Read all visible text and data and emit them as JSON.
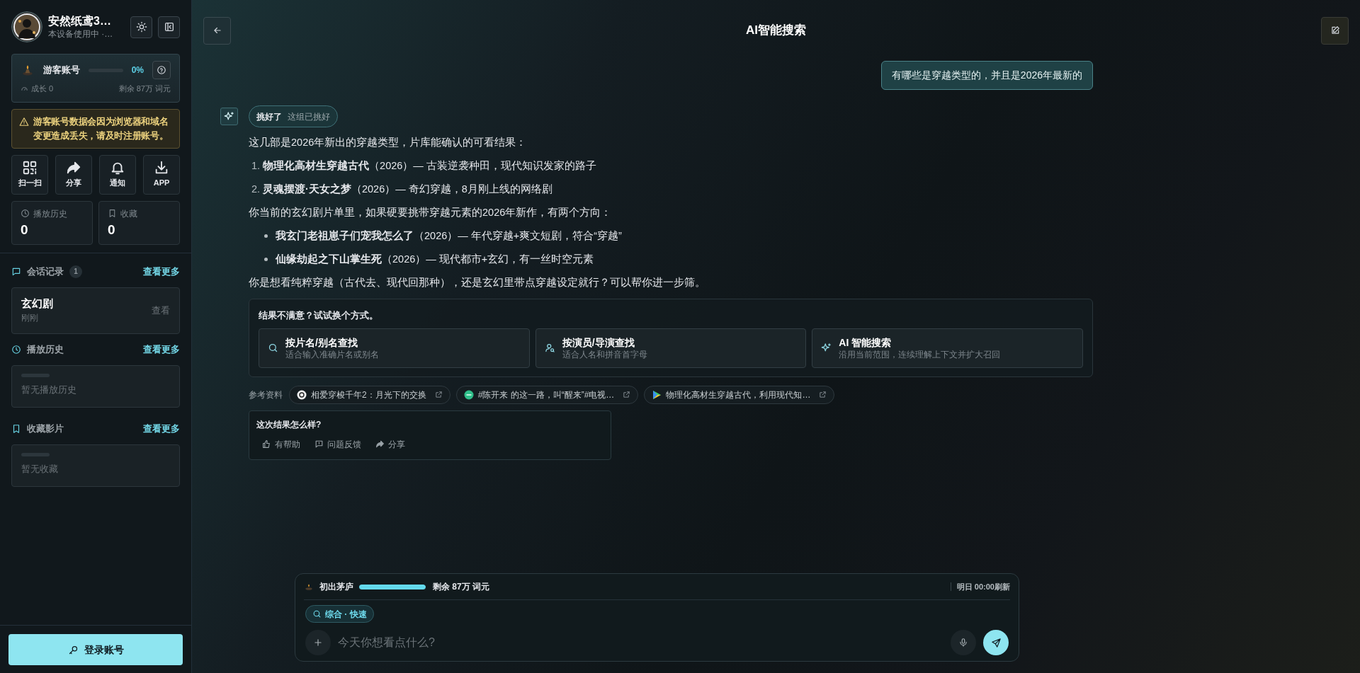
{
  "sidebar": {
    "profile": {
      "name": "安然纸鸢3…",
      "subtitle": "本设备使用中 ·…"
    },
    "account": {
      "label": "游客账号",
      "level": 0,
      "percent": "0%",
      "growth": "成长 0",
      "remaining": "剩余 87万 词元"
    },
    "warning": "游客账号数据会因为浏览器和域名变更造成丢失，请及时注册账号。",
    "quick_actions": [
      {
        "label": "扫一扫",
        "kind": "qr"
      },
      {
        "label": "分享",
        "kind": "share"
      },
      {
        "label": "通知",
        "kind": "bell"
      },
      {
        "label": "APP",
        "kind": "download"
      }
    ],
    "stats": [
      {
        "label": "播放历史",
        "value": "0",
        "kind": "clock"
      },
      {
        "label": "收藏",
        "value": "0",
        "kind": "bookmark"
      }
    ],
    "sections": [
      {
        "title": "会话记录",
        "count": "1",
        "more": "查看更多",
        "kind": "chat",
        "items": [
          {
            "title": "玄幻剧",
            "time": "刚刚",
            "action": "查看"
          }
        ]
      },
      {
        "title": "播放历史",
        "more": "查看更多",
        "kind": "clock",
        "empty": "暂无播放历史"
      },
      {
        "title": "收藏影片",
        "more": "查看更多",
        "kind": "bookmark",
        "empty": "暂无收藏"
      }
    ],
    "login_button": "登录账号"
  },
  "header": {
    "title": "AI智能搜索"
  },
  "user_message": "有哪些是穿越类型的，并且是2026年最新的",
  "assistant": {
    "badge": "挑好了",
    "badge_note": "这组已挑好",
    "blocks": [
      {
        "kind": "paragraph",
        "text": "这几部是2026年新出的穿越类型，片库能确认的可看结果："
      },
      {
        "kind": "ordered",
        "items": [
          {
            "number": "1.",
            "text": "**物理化高材生穿越古代**（2026）— 古装逆袭种田，现代知识发家的路子"
          },
          {
            "number": "2.",
            "text": "**灵魂摆渡·天女之梦**（2026）— 奇幻穿越，8月刚上线的网络剧"
          }
        ]
      },
      {
        "kind": "paragraph",
        "text": "你当前的玄幻剧片单里，如果硬要挑带穿越元素的2026年新作，有两个方向："
      },
      {
        "kind": "bullets",
        "items": [
          {
            "text": "**我玄门老祖崽子们宠我怎么了**（2026）— 年代穿越+爽文短剧，符合“穿越”"
          },
          {
            "text": "**仙缘劫起之下山掌生死**（2026）— 现代都市+玄幻，有一丝时空元素"
          }
        ]
      },
      {
        "kind": "paragraph",
        "text": "你是想看纯粹穿越（古代去、现代回那种），还是玄幻里带点穿越设定就行？可以帮你进一步筛。"
      }
    ],
    "alternatives": {
      "title": "结果不满意？试试换个方式。",
      "options": [
        {
          "title": "按片名/别名查找",
          "subtitle": "适合输入准确片名或别名",
          "kind": "search"
        },
        {
          "title": "按演员/导演查找",
          "subtitle": "适合人名和拼音首字母",
          "kind": "person"
        },
        {
          "title": "AI 智能搜索",
          "subtitle": "沿用当前范围，连续理解上下文并扩大召回",
          "kind": "sparkle"
        }
      ]
    },
    "references": {
      "label": "参考资料",
      "items": [
        {
          "title": "相爱穿梭千年2：月光下的交换",
          "kind": "white"
        },
        {
          "title": "#陈开来 的这一路，叫“醒来”#电视…",
          "kind": "green"
        },
        {
          "title": "物理化高材生穿越古代，利用现代知…",
          "kind": "play"
        }
      ]
    },
    "feedback": {
      "title": "这次结果怎么样?",
      "actions": [
        {
          "label": "有帮助",
          "kind": "thumb"
        },
        {
          "label": "问题反馈",
          "kind": "comment"
        },
        {
          "label": "分享",
          "kind": "share"
        }
      ]
    }
  },
  "composer": {
    "tier": "初出茅庐",
    "level": 1,
    "remaining": "剩余 87万 词元",
    "refresh": "明日 00:00刷新",
    "mode": "综合 · 快速",
    "placeholder": "今天你想看点什么?"
  }
}
